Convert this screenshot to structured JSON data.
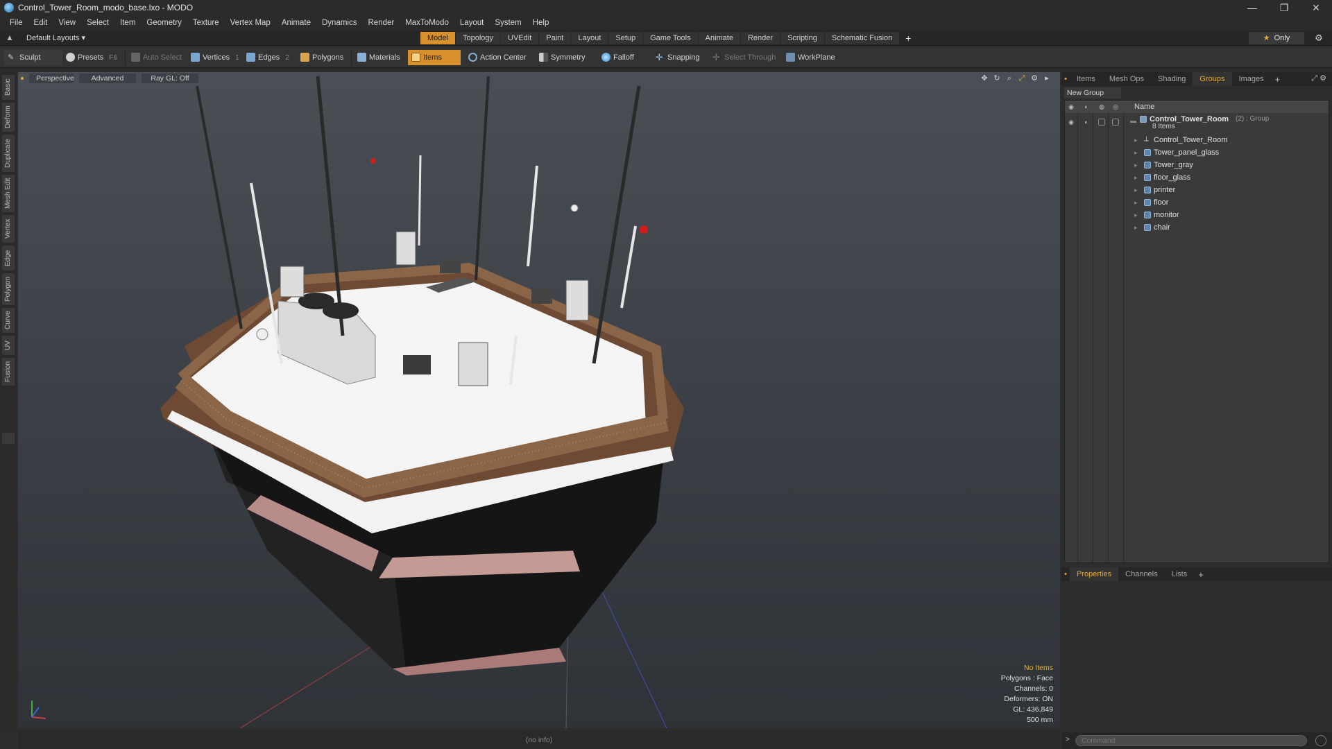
{
  "window": {
    "title": "Control_Tower_Room_modo_base.lxo - MODO",
    "minimize": "—",
    "restore": "❐",
    "close": "✕"
  },
  "menu": [
    "File",
    "Edit",
    "View",
    "Select",
    "Item",
    "Geometry",
    "Texture",
    "Vertex Map",
    "Animate",
    "Dynamics",
    "Render",
    "MaxToModo",
    "Layout",
    "System",
    "Help"
  ],
  "layoutbar": {
    "default_layouts": "Default Layouts ▾",
    "tabs": [
      "Model",
      "Topology",
      "UVEdit",
      "Paint",
      "Layout",
      "Setup",
      "Game Tools",
      "Animate",
      "Render",
      "Scripting",
      "Schematic Fusion"
    ],
    "active_tab": "Model",
    "only_label": "Only"
  },
  "toolbar": {
    "sculpt": "Sculpt",
    "presets": "Presets",
    "presets_key": "F6",
    "auto_select": "Auto Select",
    "vertices": "Vertices",
    "vertices_key": "1",
    "edges": "Edges",
    "edges_key": "2",
    "polygons": "Polygons",
    "materials": "Materials",
    "items": "Items",
    "action_center": "Action Center",
    "symmetry": "Symmetry",
    "falloff": "Falloff",
    "snapping": "Snapping",
    "select_through": "Select Through",
    "workplane": "WorkPlane"
  },
  "left_tabs": [
    "Basic",
    "Deform",
    "Duplicate",
    "Mesh Edit",
    "Vertex",
    "Edge",
    "Polygon",
    "Curve",
    "UV",
    "Fusion"
  ],
  "viewport": {
    "view": "Perspective",
    "advanced": "Advanced",
    "raygl": "Ray GL: Off",
    "stats": {
      "items": "No Items",
      "polygons": "Polygons : Face",
      "channels": "Channels: 0",
      "deformers": "Deformers: ON",
      "gl": "GL: 436,849",
      "scale": "500 mm"
    }
  },
  "status": {
    "info": "(no info)"
  },
  "right_panel": {
    "tabs": [
      "Items",
      "Mesh Ops",
      "Shading",
      "Groups",
      "Images"
    ],
    "active_tab": "Groups",
    "new_group": "New Group",
    "name_header": "Name",
    "group": {
      "name": "Control_Tower_Room",
      "meta": "(2) : Group",
      "count": "8 Items"
    },
    "items": [
      "Control_Tower_Room",
      "Tower_panel_glass",
      "Tower_gray",
      "floor_glass",
      "printer",
      "floor",
      "monitor",
      "chair"
    ],
    "bottom_tabs": [
      "Properties",
      "Channels",
      "Lists"
    ],
    "active_bottom_tab": "Properties",
    "command_placeholder": "Command"
  }
}
